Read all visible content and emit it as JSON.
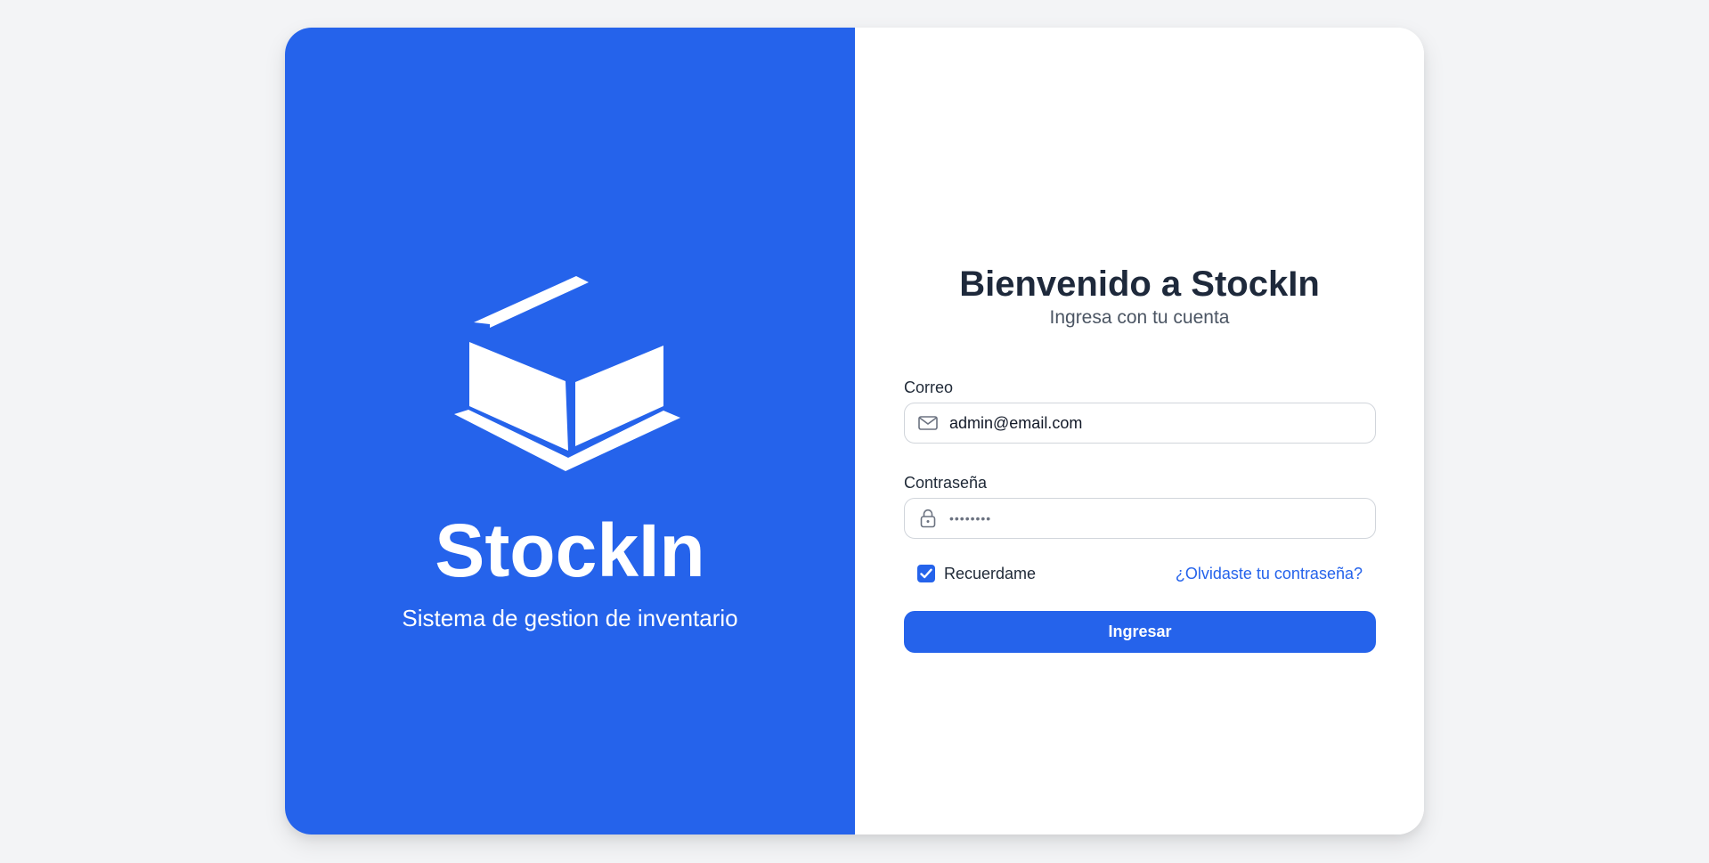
{
  "brand": {
    "name": "StockIn",
    "tagline": "Sistema de gestion de inventario",
    "logo_icon": "box-icon",
    "color": "#2563eb"
  },
  "login": {
    "title": "Bienvenido a StockIn",
    "subtitle": "Ingresa con tu cuenta",
    "email": {
      "label": "Correo",
      "value": "admin@email.com",
      "icon": "mail-icon"
    },
    "password": {
      "label": "Contraseña",
      "value": "••••••••",
      "icon": "lock-icon"
    },
    "remember": {
      "label": "Recuerdame",
      "checked": true
    },
    "forgot_link": "¿Olvidaste tu contraseña?",
    "submit_label": "Ingresar"
  }
}
